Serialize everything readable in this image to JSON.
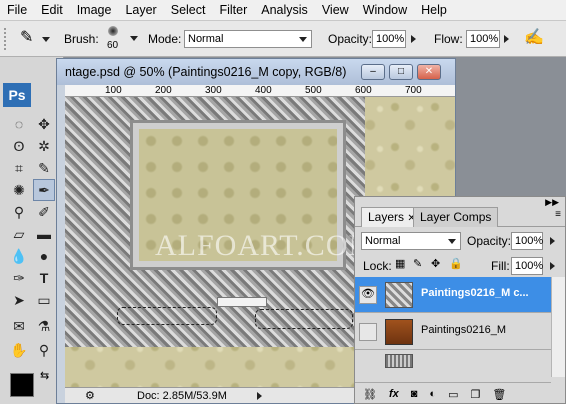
{
  "menu": [
    "File",
    "Edit",
    "Image",
    "Layer",
    "Select",
    "Filter",
    "Analysis",
    "View",
    "Window",
    "Help"
  ],
  "options": {
    "brush_label": "Brush:",
    "brush_size": "60",
    "mode_label": "Mode:",
    "mode_value": "Normal",
    "opacity_label": "Opacity:",
    "opacity_value": "100%",
    "flow_label": "Flow:",
    "flow_value": "100%"
  },
  "toolbox": {
    "logo": "Ps"
  },
  "document": {
    "title": "ntage.psd @ 50% (Paintings0216_M copy, RGB/8)",
    "ruler_ticks": [
      "100",
      "200",
      "300",
      "400",
      "500",
      "600",
      "700"
    ],
    "watermark": "ALFOART.COM",
    "status": "Doc: 2.85M/53.9M"
  },
  "layers_panel": {
    "tab_layers": "Layers",
    "tab_layer_comps": "Layer Comps",
    "blend_mode": "Normal",
    "opacity_label": "Opacity:",
    "opacity_value": "100%",
    "lock_label": "Lock:",
    "fill_label": "Fill:",
    "fill_value": "100%",
    "layers": [
      {
        "name": "Paintings0216_M c...",
        "selected": true
      },
      {
        "name": "Paintings0216_M",
        "selected": false
      }
    ]
  },
  "colors": {
    "selected_layer": "#3d8ee6",
    "accent": "#2e6fb5"
  }
}
